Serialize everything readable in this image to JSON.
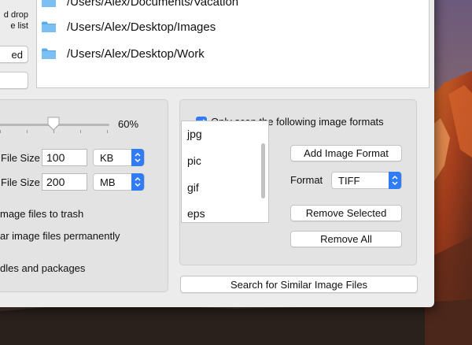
{
  "left_notes": {
    "line1": "d drop",
    "line2": "e list"
  },
  "left_buttons": {
    "button1_label": "ed",
    "button2_label": ""
  },
  "paths": [
    "/Users/Alex/Documents/Vacation",
    "/Users/Alex/Desktop/Images",
    "/Users/Alex/Desktop/Work"
  ],
  "similarity": {
    "value_text": "60%",
    "value_fraction": 0.6
  },
  "filesize": {
    "min_label": "File Size",
    "min_value": "100",
    "min_unit": "KB",
    "max_label": "File Size",
    "max_value": "200",
    "max_unit": "MB"
  },
  "options": {
    "trash_label": "mage files to trash",
    "delete_label": "ar image files permanently",
    "bundles_label": "dles and packages"
  },
  "formats": {
    "checkbox_label": "Only scan the following image formats",
    "checked": true,
    "list": [
      "jpg",
      "pic",
      "gif",
      "eps"
    ],
    "add_button": "Add Image Format",
    "format_label": "Format",
    "format_value": "TIFF",
    "remove_selected": "Remove Selected",
    "remove_all": "Remove All"
  },
  "search_button": "Search for Similar Image Files",
  "colors": {
    "accent": "#2f7cf6",
    "folder": "#5aa9ea"
  }
}
